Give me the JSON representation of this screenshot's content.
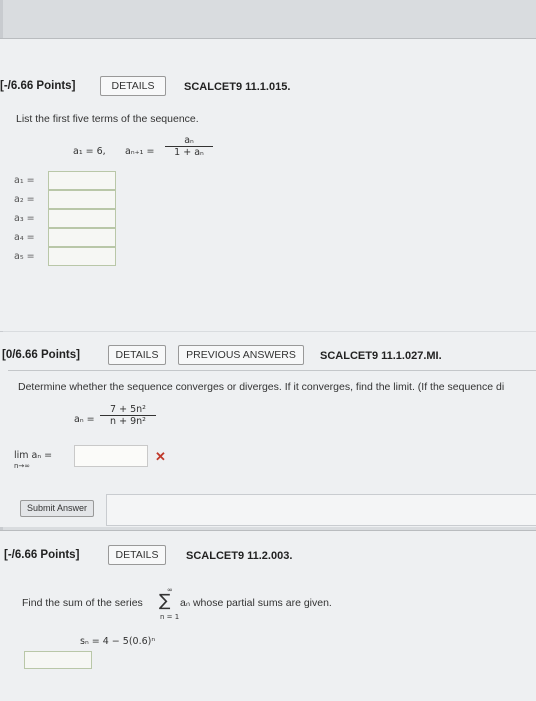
{
  "q1": {
    "points": "[-/6.66 Points]",
    "details_label": "DETAILS",
    "code": "SCALCET9 11.1.015.",
    "prompt": "List the first five terms of the sequence.",
    "eq_a1": "a₁ = 6,",
    "eq_an1": "aₙ₊₁ =",
    "frac_num": "aₙ",
    "frac_den": "1 + aₙ",
    "labels": [
      "a₁ =",
      "a₂ =",
      "a₃ =",
      "a₄ =",
      "a₅ ="
    ]
  },
  "q2": {
    "points": "[0/6.66 Points]",
    "details_label": "DETAILS",
    "prev_label": "PREVIOUS ANSWERS",
    "code": "SCALCET9 11.1.027.MI.",
    "prompt": "Determine whether the sequence converges or diverges. If it converges, find the limit. (If the sequence di",
    "eq_an": "aₙ =",
    "frac_num": "7 + 5n²",
    "frac_den": "n + 9n²",
    "lim_label": "lim aₙ =",
    "lim_sub": "n→∞",
    "wrong_mark": "✕",
    "submit_label": "Submit Answer"
  },
  "q3": {
    "points": "[-/6.66 Points]",
    "details_label": "DETAILS",
    "code": "SCALCET9 11.2.003.",
    "prompt_a": "Find the sum of the series",
    "sigma_top": "∞",
    "sigma": "∑",
    "sigma_bottom": "n = 1",
    "prompt_b": "aₙ whose partial sums are given.",
    "sn_eq": "sₙ = 4 − 5(0.6)ⁿ"
  },
  "colors": {
    "wrong": "#c0392b",
    "panel": "#eef0f2"
  }
}
